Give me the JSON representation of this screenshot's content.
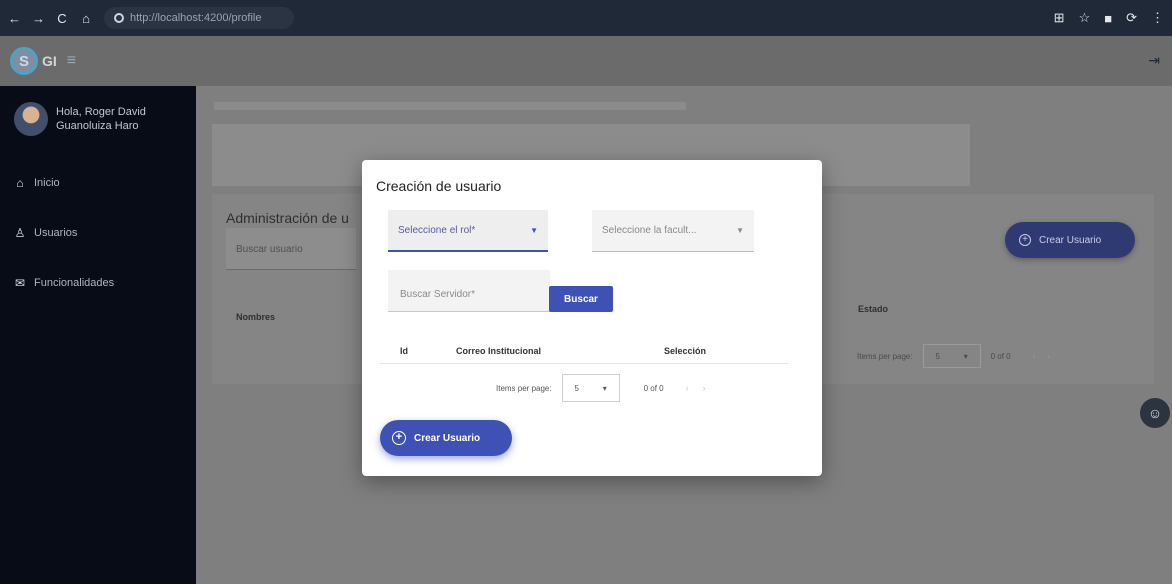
{
  "browser": {
    "url": "http://localhost:4200/profile",
    "nav_icons": [
      "←",
      "→",
      "C",
      "⌂"
    ],
    "right_icons": [
      "⊞",
      "☆",
      "■",
      "⟳",
      "⋮"
    ]
  },
  "header": {
    "logo_text": "GI",
    "menu_icon": "≡",
    "logout_icon": "⇥"
  },
  "sidebar": {
    "greeting_line1": "Hola, Roger David",
    "greeting_line2": "Guanoluiza Haro",
    "items": [
      {
        "label": "Inicio",
        "icon": "home-icon",
        "glyph": "⌂"
      },
      {
        "label": "Usuarios",
        "icon": "users-icon",
        "glyph": "👥"
      },
      {
        "label": "Funcionalidades",
        "icon": "mail-icon",
        "glyph": "✉"
      }
    ]
  },
  "background": {
    "card_title": "Administración de u",
    "search_placeholder": "Buscar usuario",
    "create_button": "Crear Usuario",
    "col_nombres": "Nombres",
    "col_estado": "Estado",
    "pager_label": "Items per page:",
    "pager_value": "5",
    "pager_range": "0 of 0"
  },
  "modal": {
    "title": "Creación de usuario",
    "select_rol": "Seleccione el rol*",
    "select_facultad": "Seleccione la facult...",
    "search_servidor": "Buscar Servidor*",
    "buscar_button": "Buscar",
    "columns": {
      "id": "Id",
      "correo": "Correo Institucional",
      "seleccion": "Selección"
    },
    "pager_label": "Items per page:",
    "pager_value": "5",
    "pager_range": "0 of 0",
    "create_button": "Crear Usuario"
  },
  "colors": {
    "primary": "#3f51b5",
    "sidebar": "#070c17"
  }
}
